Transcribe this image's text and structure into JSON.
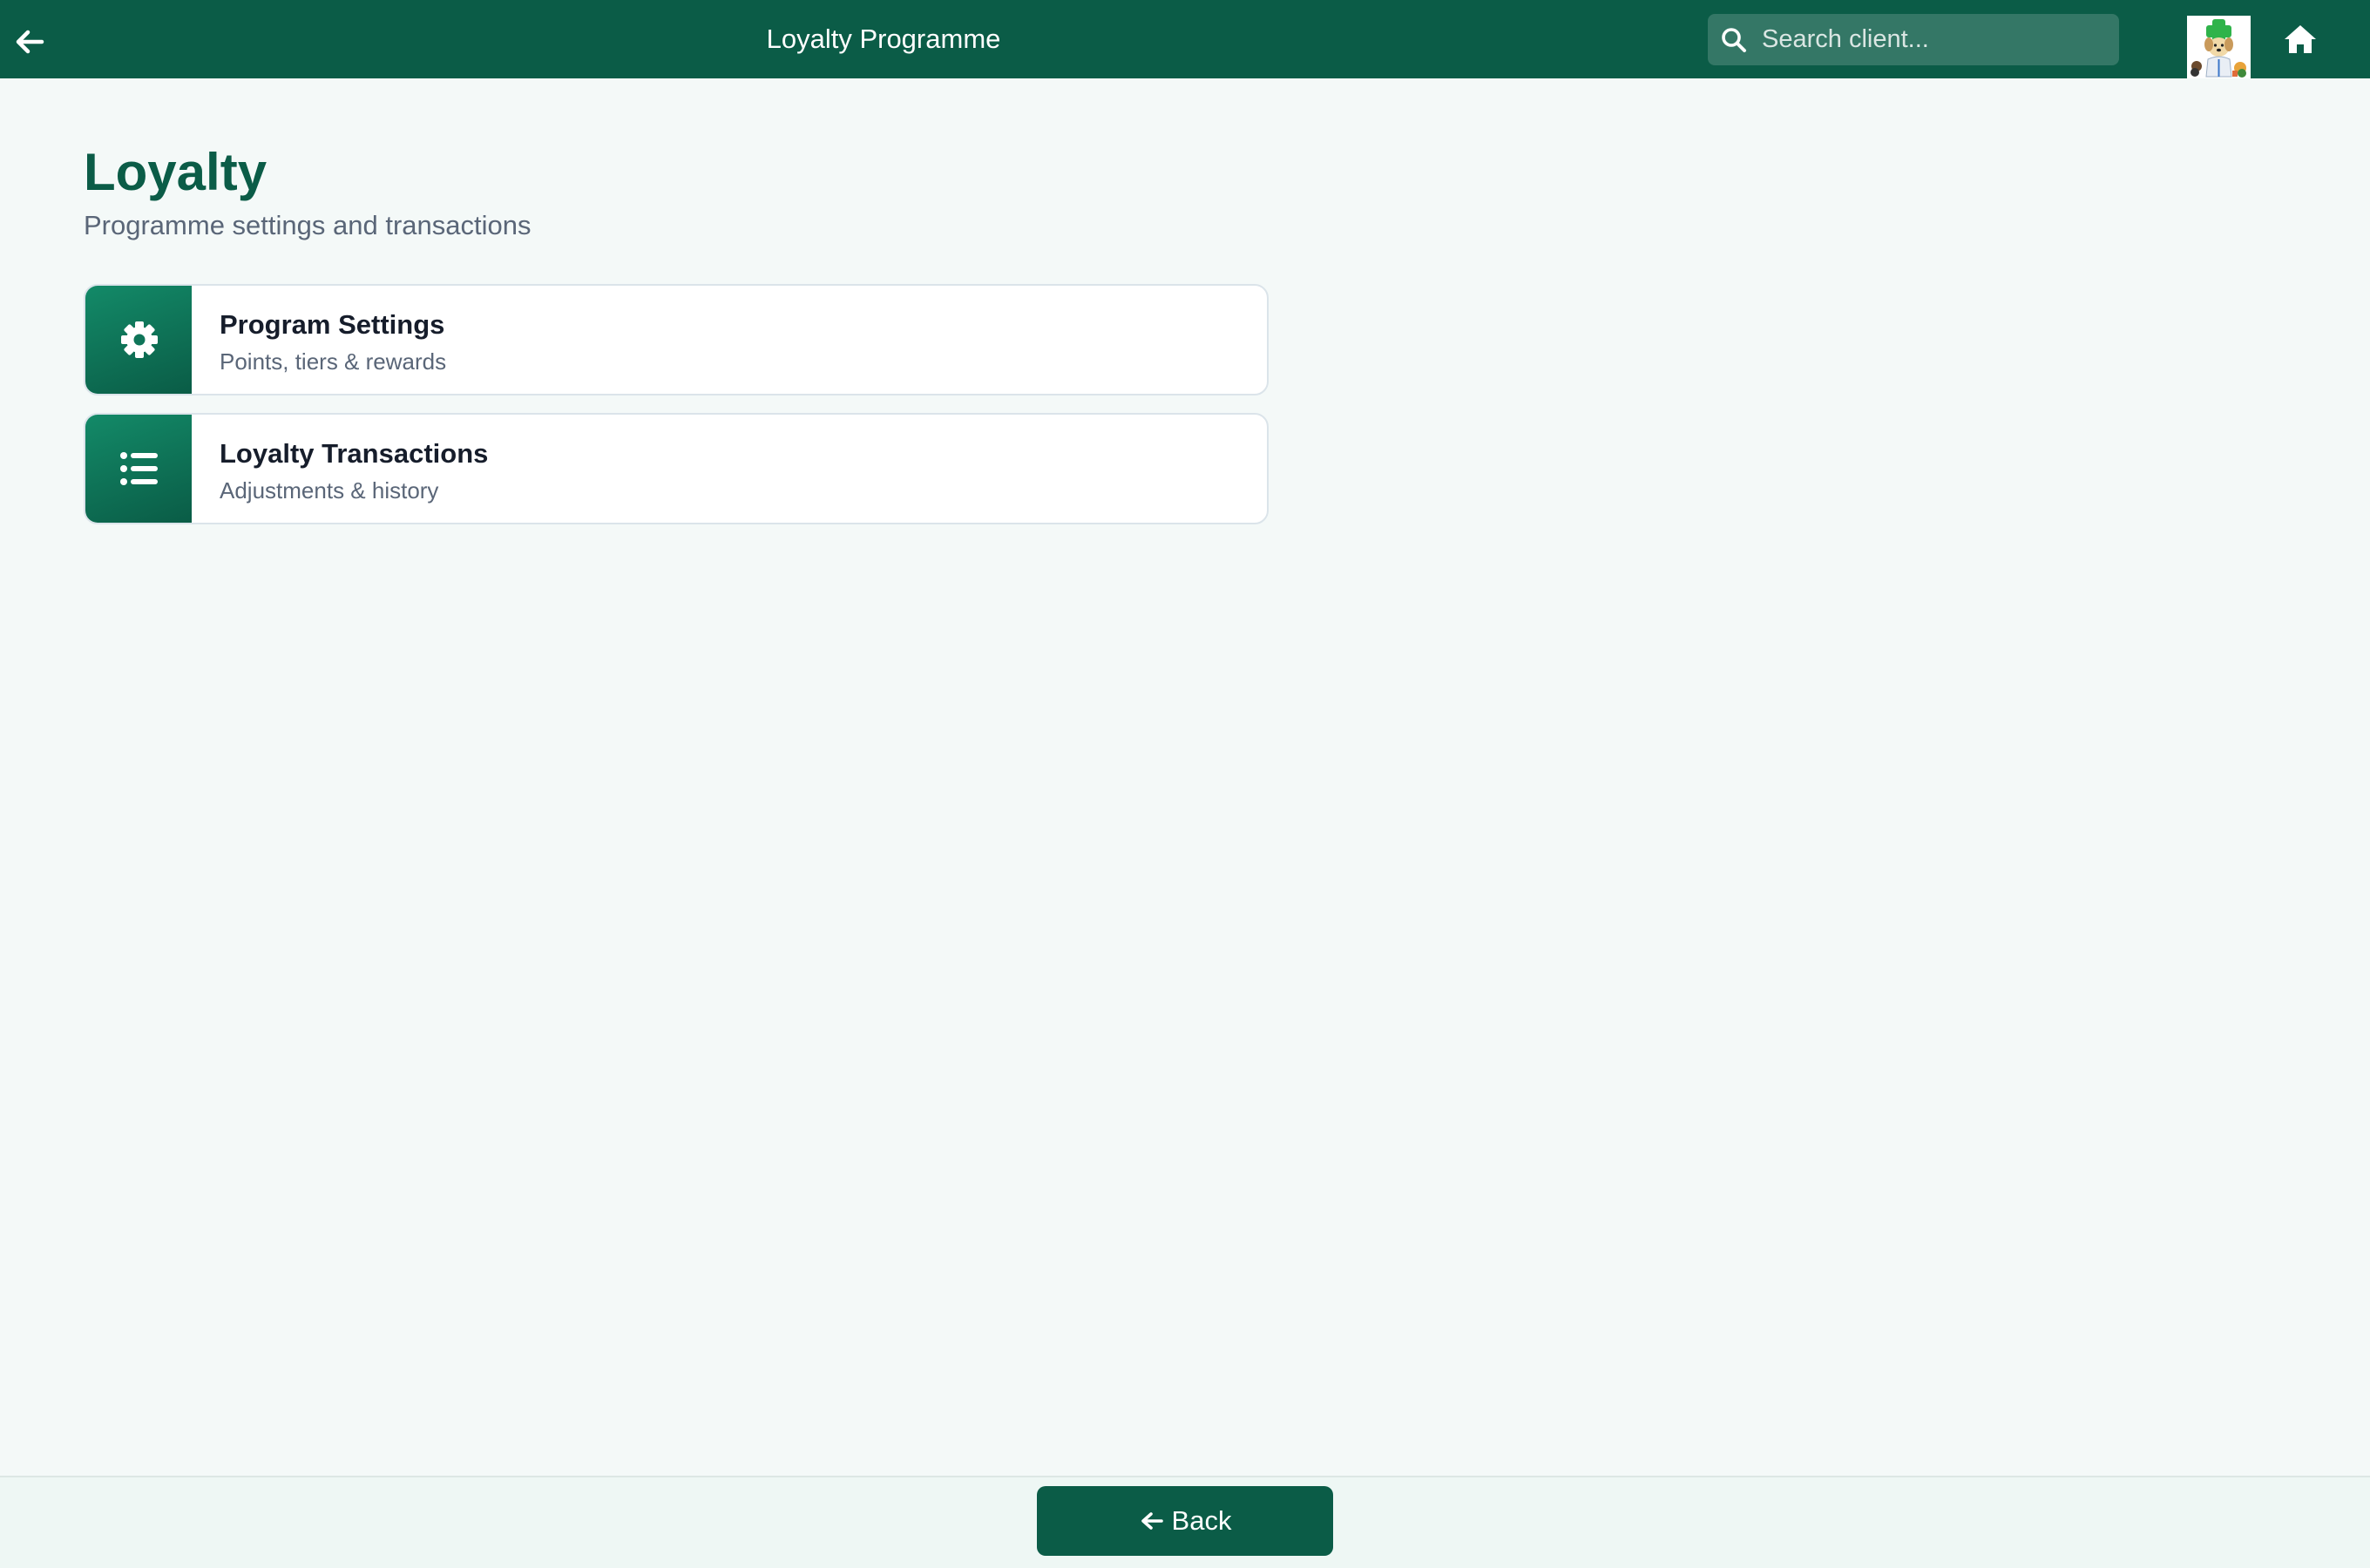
{
  "header": {
    "title": "Loyalty Programme",
    "search_placeholder": "Search client...",
    "back_icon": "arrow-left-icon",
    "search_icon": "search-icon",
    "home_icon": "home-icon",
    "avatar": "clinic-logo-avatar"
  },
  "page": {
    "title": "Loyalty",
    "subtitle": "Programme settings and transactions"
  },
  "cards": [
    {
      "title": "Program Settings",
      "description": "Points, tiers & rewards",
      "icon": "gear-icon"
    },
    {
      "title": "Loyalty Transactions",
      "description": "Adjustments & history",
      "icon": "list-icon"
    }
  ],
  "footer": {
    "back_label": "Back",
    "back_icon": "arrow-left-icon"
  },
  "colors": {
    "brand": "#0b5c47",
    "background": "#f4f9f8",
    "card_border": "#dbe4ea",
    "text_dark": "#161d2b",
    "text_muted": "#5a6678"
  }
}
